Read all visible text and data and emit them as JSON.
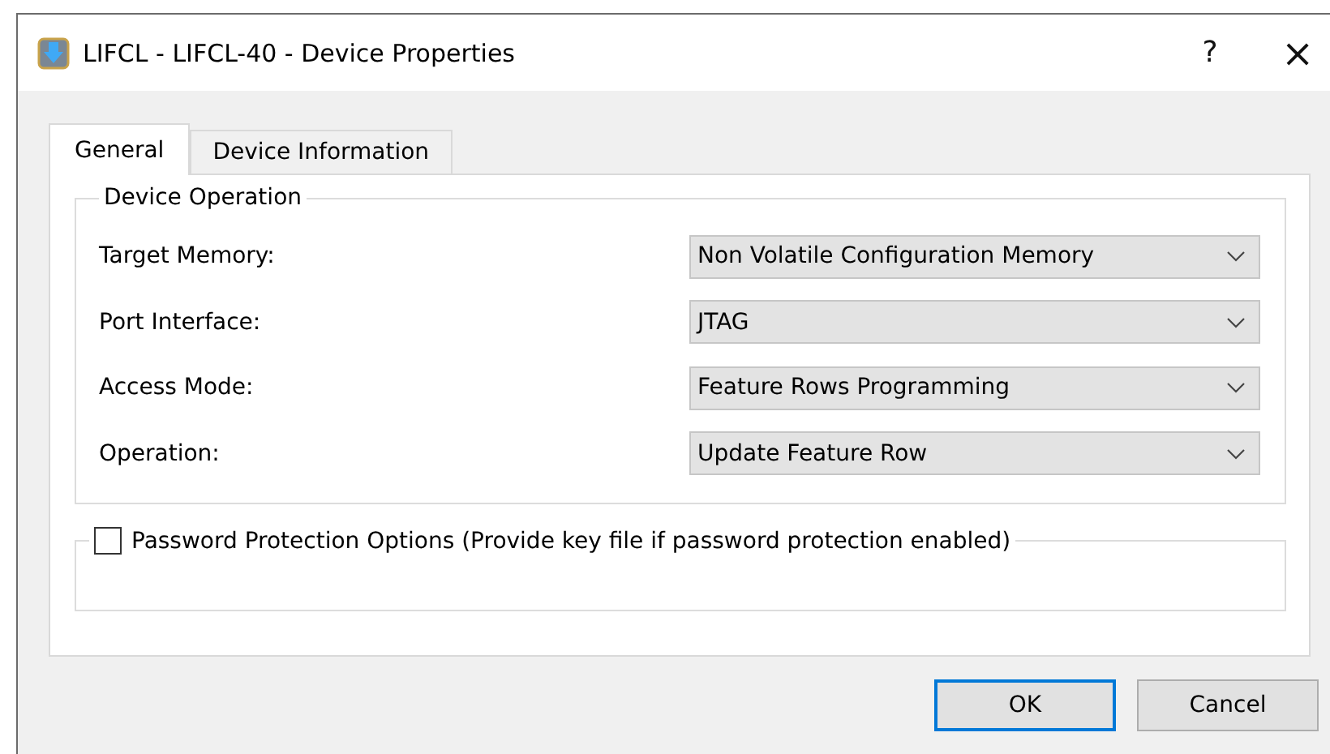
{
  "window": {
    "title": "LIFCL - LIFCL-40 - Device Properties",
    "help": "?",
    "close": "×"
  },
  "tabs": [
    {
      "label": "General",
      "selected": true
    },
    {
      "label": "Device Information",
      "selected": false
    }
  ],
  "device_operation": {
    "title": "Device Operation",
    "fields": [
      {
        "label": "Target Memory:",
        "value": "Non Volatile Configuration Memory"
      },
      {
        "label": "Port Interface:",
        "value": "JTAG"
      },
      {
        "label": "Access Mode:",
        "value": "Feature Rows Programming"
      },
      {
        "label": "Operation:",
        "value": "Update Feature Row"
      }
    ]
  },
  "password_protection": {
    "label": "Password Protection Options (Provide key file if password protection enabled)",
    "checked": false
  },
  "buttons": [
    {
      "label": "OK",
      "default": true
    },
    {
      "label": "Cancel",
      "default": false
    }
  ]
}
